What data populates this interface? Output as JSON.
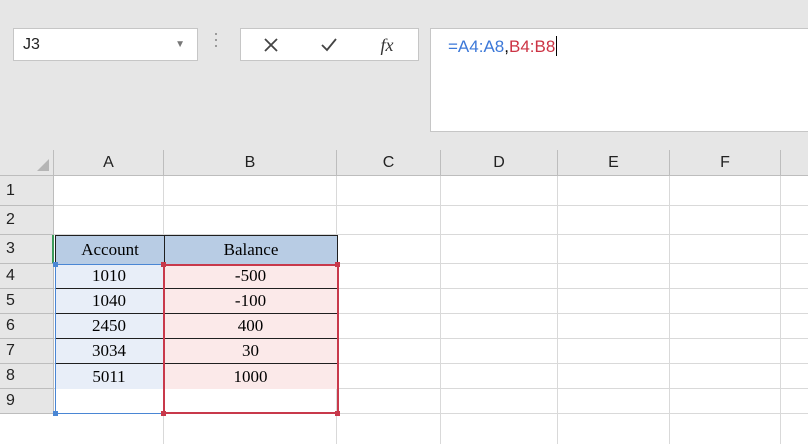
{
  "name_box": {
    "value": "J3"
  },
  "formula_bar": {
    "fx_label": "fx",
    "range1": "=A4:A8",
    "separator": ",",
    "range2": "B4:B8"
  },
  "columns": [
    "A",
    "B",
    "C",
    "D",
    "E",
    "F"
  ],
  "rows": [
    "1",
    "2",
    "3",
    "4",
    "5",
    "6",
    "7",
    "8",
    "9"
  ],
  "table": {
    "headers": [
      "Account",
      "Balance"
    ],
    "accounts": [
      "1010",
      "1040",
      "2450",
      "3034",
      "5011"
    ],
    "balances": [
      "-500",
      "-100",
      "400",
      "30",
      "1000"
    ]
  },
  "colors": {
    "range1_ref": "#3c78d8",
    "range2_ref": "#cc3344",
    "header_fill": "#b8cce4",
    "account_fill": "#e8eef8",
    "balance_fill": "#fbe9e9"
  }
}
